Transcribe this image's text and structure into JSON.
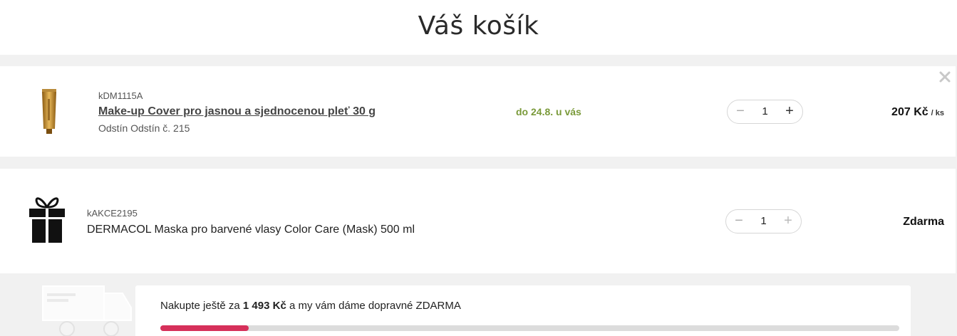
{
  "header": {
    "title": "Váš košík"
  },
  "cart": {
    "items": [
      {
        "code": "kDM1115A",
        "name": "Make-up Cover pro jasnou a sjednocenou pleť 30 g",
        "variant": "Odstín Odstín č. 215",
        "delivery": "do 24.8. u vás",
        "quantity": "1",
        "price": "207 Kč",
        "price_unit": "/ ks",
        "remove_icon": "close-icon",
        "image_icon": "makeup-tube-image"
      },
      {
        "code": "kAKCE2195",
        "name": "DERMACOL Maska pro barvené vlasy Color Care (Mask) 500 ml",
        "quantity": "1",
        "price": "Zdarma",
        "image_icon": "gift-icon"
      }
    ],
    "stepper": {
      "minus": "−",
      "plus": "+"
    }
  },
  "shipping": {
    "text_before": "Nakupte ještě za ",
    "amount": "1 493 Kč",
    "text_after": " a my vám dáme dopravné ZDARMA",
    "progress_fraction": 0.12,
    "accent_color": "#d6305a",
    "icon": "truck-icon"
  }
}
